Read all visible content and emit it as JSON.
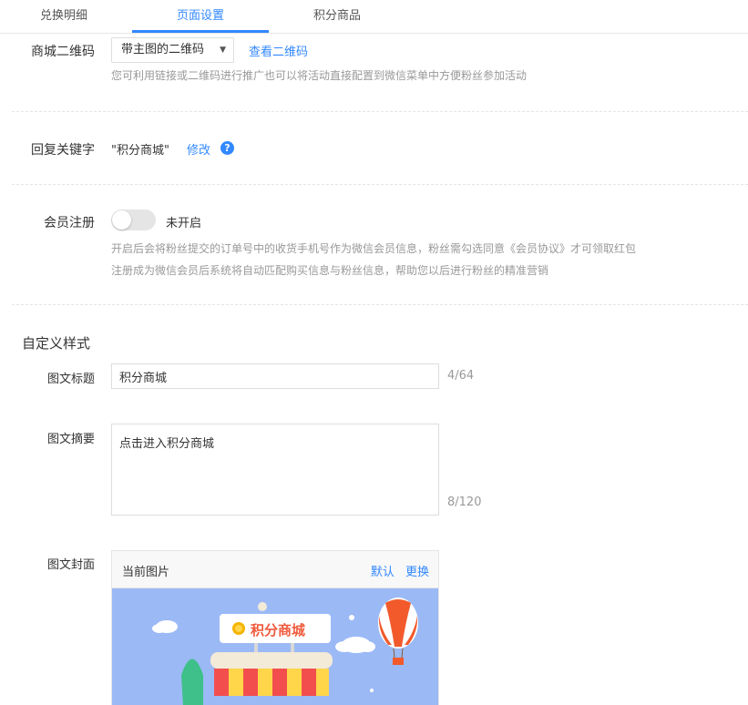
{
  "tabs": [
    {
      "label": "兑换明细"
    },
    {
      "label": "页面设置"
    },
    {
      "label": "积分商品"
    }
  ],
  "qrcode": {
    "label": "商城二维码",
    "select_value": "带主图的二维码",
    "view_link": "查看二维码",
    "help": "您可利用链接或二维码进行推广也可以将活动直接配置到微信菜单中方便粉丝参加活动"
  },
  "keyword": {
    "label": "回复关键字",
    "value": "\"积分商城\"",
    "edit_link": "修改",
    "help_icon": "?"
  },
  "member": {
    "label": "会员注册",
    "status": "未开启",
    "enabled": false,
    "help_line1": "开启后会将粉丝提交的订单号中的收货手机号作为微信会员信息，粉丝需勾选同意《会员协议》才可领取红包",
    "help_line2": "注册成为微信会员后系统将自动匹配购买信息与粉丝信息，帮助您以后进行粉丝的精准营销"
  },
  "custom": {
    "section_title": "自定义样式",
    "title_label": "图文标题",
    "title_value": "积分商城",
    "title_count": "4/64",
    "summary_label": "图文摘要",
    "summary_value": "点击进入积分商城",
    "summary_count": "8/120",
    "cover_label": "图文封面",
    "cover_header": "当前图片",
    "cover_default": "默认",
    "cover_change": "更换",
    "banner_text": "积分商城"
  },
  "colors": {
    "accent": "#3388ff",
    "banner_bg": "#9bb9f5"
  }
}
